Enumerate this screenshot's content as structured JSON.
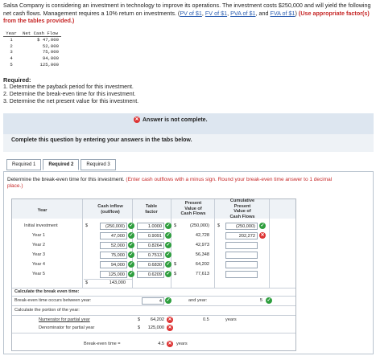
{
  "intro": {
    "text_a": "Salsa Company is considering an investment in technology to improve its operations. The investment costs $250,000 and will yield the following net cash flows. Management requires a 10% return on investments. (",
    "links": [
      "PV of $1",
      "FV of $1",
      "PVA of $1",
      "FVA of $1"
    ],
    "sep1": ", ",
    "sep2": ", ",
    "sep3": ", and ",
    "text_b": ") ",
    "use_note": "(Use appropriate factor(s) from the tables provided.)"
  },
  "cash_flow_table": {
    "headers": [
      "Year",
      "Net Cash Flow"
    ],
    "rows": [
      {
        "year": "1",
        "value": "$ 47,000"
      },
      {
        "year": "2",
        "value": "52,000"
      },
      {
        "year": "3",
        "value": "75,000"
      },
      {
        "year": "4",
        "value": "94,000"
      },
      {
        "year": "5",
        "value": "125,000"
      }
    ]
  },
  "required": {
    "title": "Required:",
    "items": [
      "1. Determine the payback period for this investment.",
      "2. Determine the break-even time for this investment.",
      "3. Determine the net present value for this investment."
    ]
  },
  "banner": {
    "message": "Answer is not complete."
  },
  "panel": {
    "message": "Complete this question by entering your answers in the tabs below."
  },
  "tabs": [
    "Required 1",
    "Required 2",
    "Required 3"
  ],
  "instructions": {
    "main": "Determine the break-even time for this investment. ",
    "red": "(Enter cash outflows with a minus sign. Round your break-even time answer to 1 decimal place.)"
  },
  "worksheet": {
    "col_year": "Year",
    "col_cash": "Cash inflow\n(outflow)",
    "col_factor": "Table\nfactor",
    "col_pv": "Present\nValue of\nCash Flows",
    "col_cum": "Cumulative\nPresent\nValue of\nCash Flows",
    "rows": [
      {
        "label": "Initial investment",
        "cash": "(250,000)",
        "factor": "1.0000",
        "pv": "(250,000)",
        "cum": "(250,000)"
      },
      {
        "label": "Year 1",
        "cash": "47,000",
        "factor": "0.9091",
        "pv": "42,728",
        "cum": "202,272"
      },
      {
        "label": "Year 2",
        "cash": "52,000",
        "factor": "0.8264",
        "pv": "42,973",
        "cum": ""
      },
      {
        "label": "Year 3",
        "cash": "75,000",
        "factor": "0.7513",
        "pv": "56,348",
        "cum": ""
      },
      {
        "label": "Year 4",
        "cash": "94,000",
        "factor": "0.6830",
        "pv": "64,202",
        "cum": ""
      },
      {
        "label": "Year 5",
        "cash": "125,000",
        "factor": "0.6209",
        "pv": "77,613",
        "cum": ""
      }
    ],
    "total_cash": "143,000",
    "dollar": "$",
    "calc_title": "Calculate the break even time:",
    "between_label": "Break-even time occurs between year:",
    "between_a": "4",
    "and_label": "and year:",
    "between_b": "5",
    "portion_label": "Calculate the portion of the year:",
    "numerator_label": "Numerator for partial year",
    "numerator_value": "64,202",
    "portion_value": "0.5",
    "years_label": "years",
    "denominator_label": "Denominator for partial year",
    "denominator_value": "125,000",
    "be_label": "Break-even time =",
    "be_value": "4.5",
    "be_unit": "years"
  },
  "colors": {
    "correct": "#2e9e3e",
    "incorrect": "#d33333",
    "link": "#2a5db0",
    "banner": "#dde6f0"
  },
  "icons": {
    "correct": "check-circle-icon",
    "incorrect": "x-circle-icon"
  }
}
